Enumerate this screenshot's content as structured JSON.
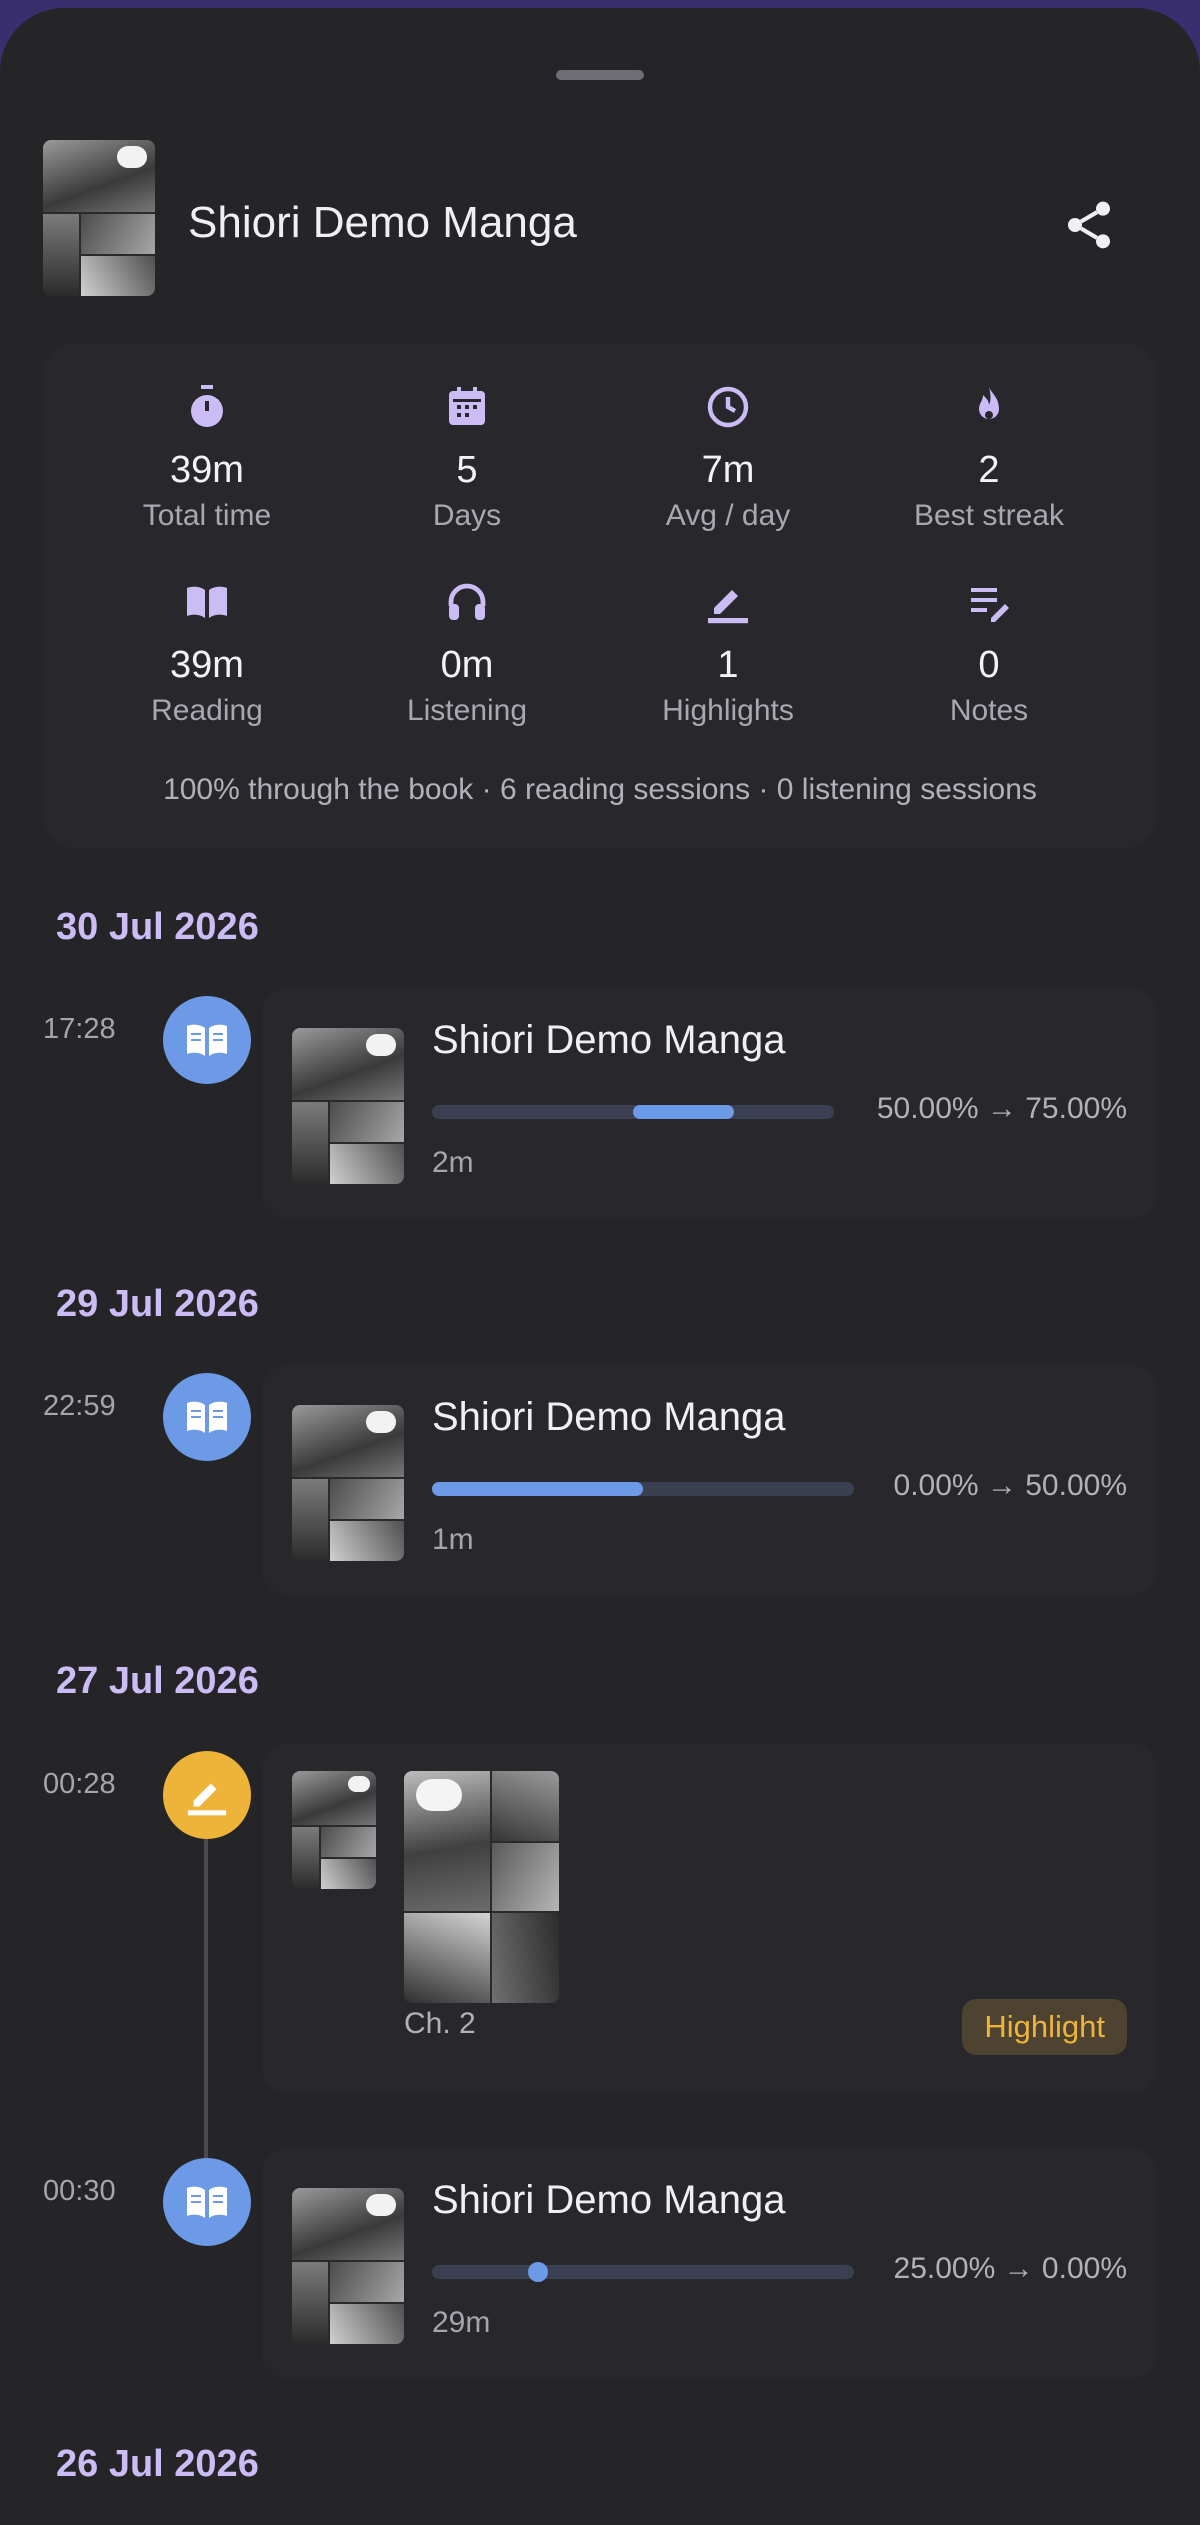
{
  "header": {
    "title": "Shiori Demo Manga"
  },
  "icons": {
    "share": "share-icon"
  },
  "colors": {
    "accent": "#cbbcf5",
    "reading": "#6d9ae6",
    "highlight": "#eeb43a",
    "background": "#252528"
  },
  "stats": [
    {
      "icon": "timer-icon",
      "value": "39m",
      "label": "Total time"
    },
    {
      "icon": "calendar-icon",
      "value": "5",
      "label": "Days"
    },
    {
      "icon": "clock-icon",
      "value": "7m",
      "label": "Avg / day"
    },
    {
      "icon": "flame-icon",
      "value": "2",
      "label": "Best streak"
    },
    {
      "icon": "book-open-icon",
      "value": "39m",
      "label": "Reading"
    },
    {
      "icon": "headphones-icon",
      "value": "0m",
      "label": "Listening"
    },
    {
      "icon": "pen-icon",
      "value": "1",
      "label": "Highlights"
    },
    {
      "icon": "note-edit-icon",
      "value": "0",
      "label": "Notes"
    }
  ],
  "summary": "100% through the book · 6 reading sessions · 0 listening sessions",
  "timeline": [
    {
      "date": "30 Jul 2026",
      "entries": [
        {
          "time": "17:28",
          "type": "reading",
          "title": "Shiori Demo Manga",
          "progress": "50.00% → 75.00%",
          "from": 0.5,
          "to": 0.75,
          "duration": "2m"
        }
      ]
    },
    {
      "date": "29 Jul 2026",
      "entries": [
        {
          "time": "22:59",
          "type": "reading",
          "title": "Shiori Demo Manga",
          "progress": "0.00% → 50.00%",
          "from": 0.0,
          "to": 0.5,
          "duration": "1m"
        }
      ]
    },
    {
      "date": "27 Jul 2026",
      "entries": [
        {
          "time": "00:28",
          "type": "highlight",
          "chapter": "Ch. 2",
          "badge": "Highlight"
        },
        {
          "time": "00:30",
          "type": "reading",
          "title": "Shiori Demo Manga",
          "progress": "25.00% → 0.00%",
          "from": 0.25,
          "to": 0.0,
          "duration": "29m"
        }
      ]
    },
    {
      "date": "26 Jul 2026",
      "entries": []
    }
  ]
}
